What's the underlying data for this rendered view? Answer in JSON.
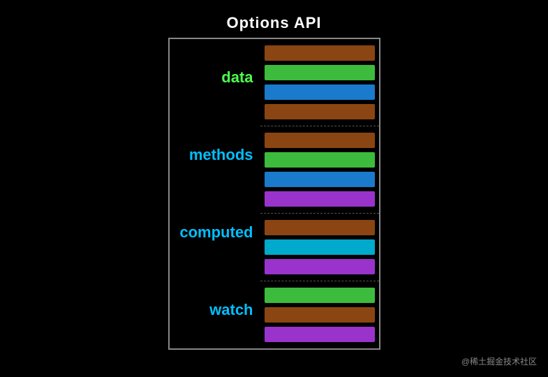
{
  "title": "Options API",
  "groups": [
    {
      "id": "data",
      "label": "data",
      "labelClass": "label-data",
      "bars": [
        {
          "color": "bar-brown"
        },
        {
          "color": "bar-green"
        },
        {
          "color": "bar-blue"
        },
        {
          "color": "bar-brown"
        }
      ]
    },
    {
      "id": "methods",
      "label": "methods",
      "labelClass": "label-methods",
      "bars": [
        {
          "color": "bar-brown"
        },
        {
          "color": "bar-green"
        },
        {
          "color": "bar-blue"
        },
        {
          "color": "bar-purple"
        }
      ]
    },
    {
      "id": "computed",
      "label": "computed",
      "labelClass": "label-computed",
      "bars": [
        {
          "color": "bar-brown"
        },
        {
          "color": "bar-cyan"
        },
        {
          "color": "bar-purple"
        }
      ]
    },
    {
      "id": "watch",
      "label": "watch",
      "labelClass": "label-watch",
      "bars": [
        {
          "color": "bar-green"
        },
        {
          "color": "bar-brown"
        },
        {
          "color": "bar-purple"
        }
      ]
    }
  ],
  "watermark": "@稀土掘金技术社区"
}
